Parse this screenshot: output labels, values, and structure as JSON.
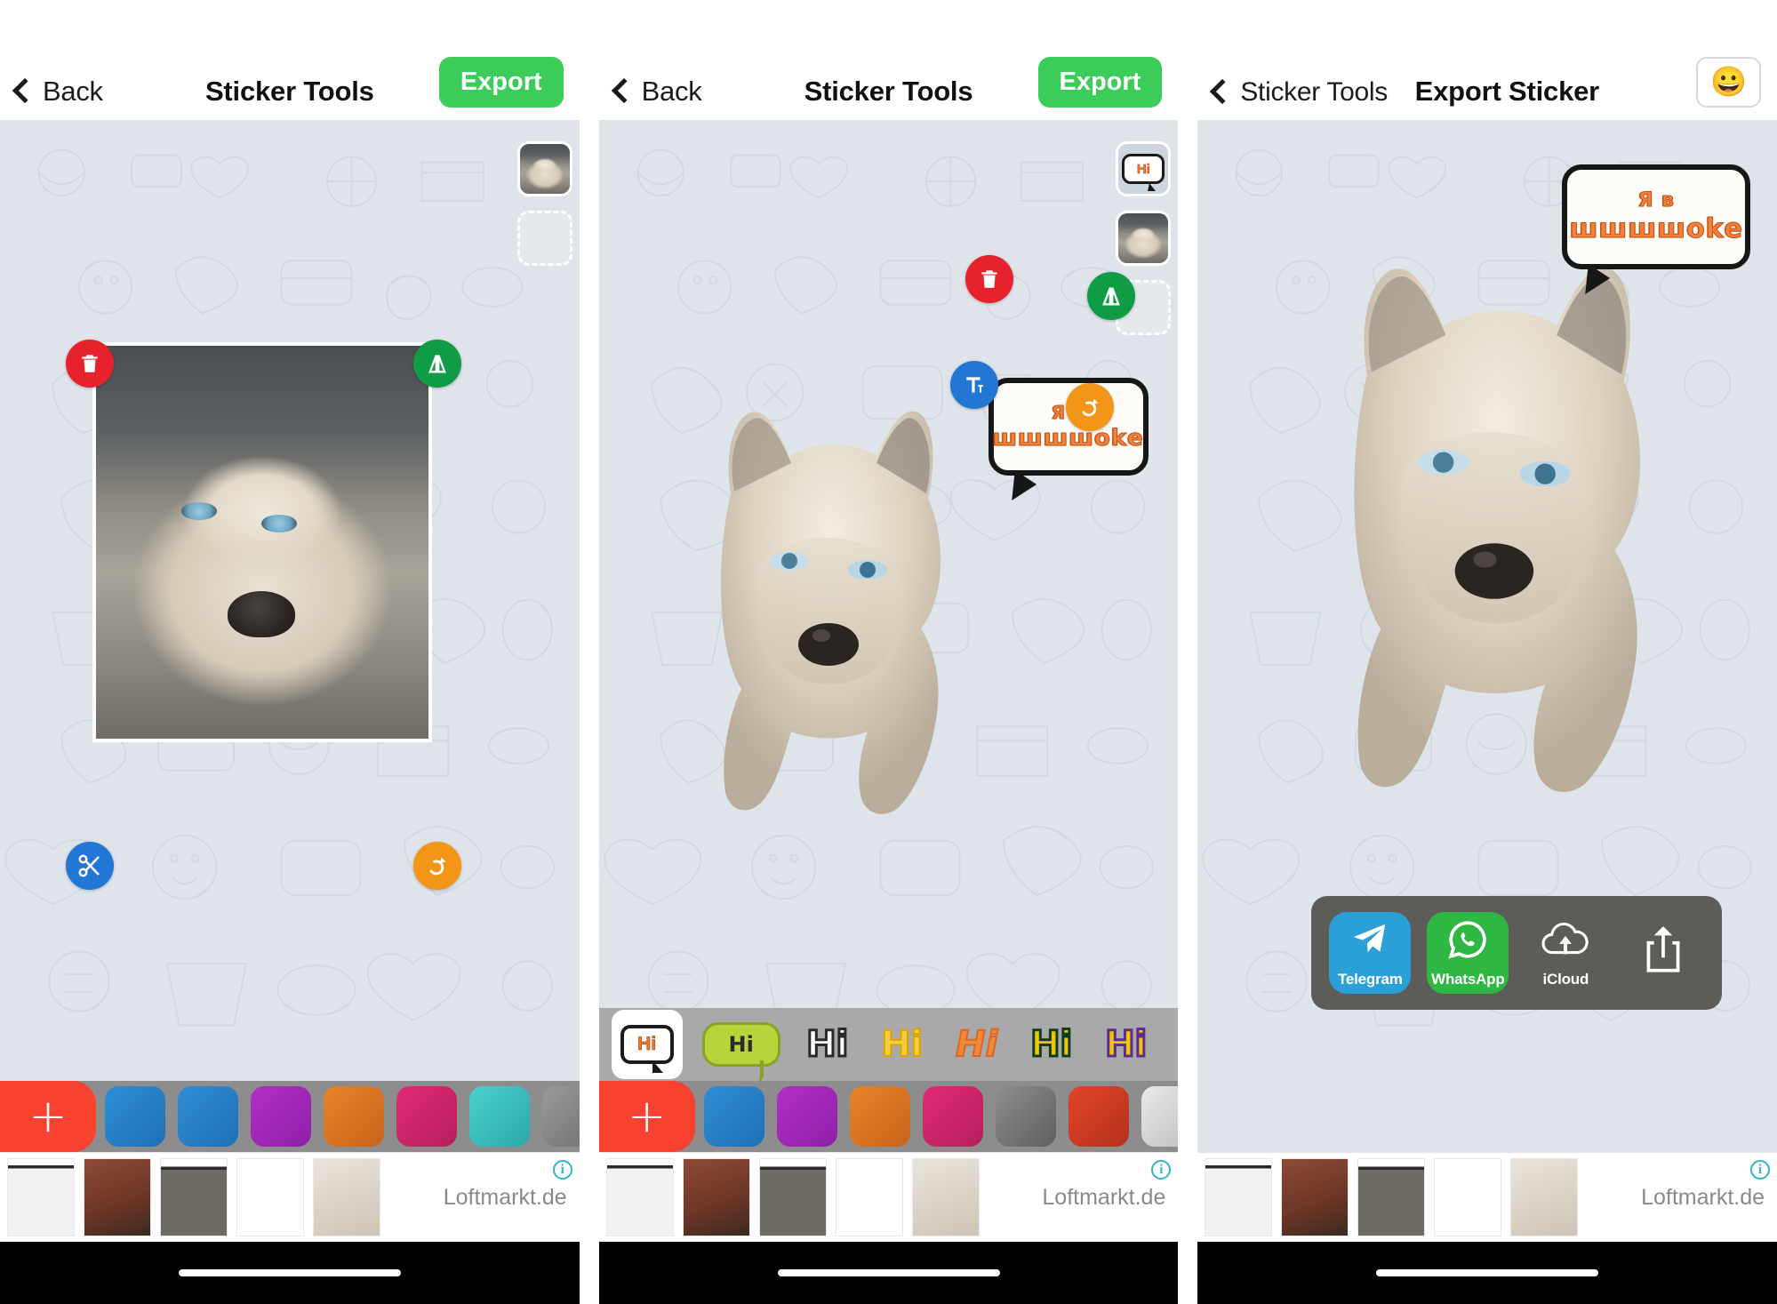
{
  "screens": [
    {
      "id": "panel-1",
      "nav": {
        "back_label": "Back",
        "title": "Sticker Tools",
        "action_label": "Export"
      },
      "tools": [
        {
          "name": "delete",
          "glyph": "trash",
          "color": "#e8222c"
        },
        {
          "name": "flip",
          "glyph": "flip",
          "color": "#0f9c45"
        },
        {
          "name": "crop",
          "glyph": "scissors",
          "color": "#2277d4"
        },
        {
          "name": "rotate",
          "glyph": "rotate",
          "color": "#f39516"
        }
      ],
      "layers": [
        "photo-thumbnail",
        "empty-slot"
      ],
      "bottom_bar": {
        "add_label": "+",
        "stickers": [
          "face-blue-1",
          "face-blue-2",
          "face-magenta",
          "face-orange",
          "face-pink",
          "face-teal",
          "face-gray"
        ]
      },
      "ad": {
        "brand": "Loftmarkt.de",
        "info_glyph": "i"
      }
    },
    {
      "id": "panel-2",
      "nav": {
        "back_label": "Back",
        "title": "Sticker Tools",
        "action_label": "Export"
      },
      "tools": [
        {
          "name": "delete",
          "glyph": "trash",
          "color": "#e8222c"
        },
        {
          "name": "flip",
          "glyph": "flip",
          "color": "#0f9c45"
        },
        {
          "name": "edit-text",
          "glyph": "T",
          "color": "#2277d4"
        },
        {
          "name": "rotate",
          "glyph": "rotate",
          "color": "#f39516"
        }
      ],
      "bubble": {
        "line1": "Я в",
        "line2": "шшшшоkе"
      },
      "layers": [
        "text-bubble-thumbnail",
        "photo-thumbnail",
        "empty-slot"
      ],
      "text_strip": {
        "items": [
          {
            "label": "Hi",
            "style": "bubble",
            "selected": true
          },
          {
            "label": "Hi",
            "style": "green"
          },
          {
            "label": "Hi",
            "style": "white"
          },
          {
            "label": "Hi",
            "style": "yellow"
          },
          {
            "label": "Hi",
            "style": "orange"
          },
          {
            "label": "Hi",
            "style": "gold"
          },
          {
            "label": "Hi",
            "style": "purple"
          }
        ]
      },
      "bottom_bar": {
        "add_label": "+",
        "stickers": [
          "face-blue",
          "face-magenta",
          "face-orange",
          "face-pink",
          "face-gray",
          "face-red",
          "face-white"
        ]
      },
      "ad": {
        "brand": "Loftmarkt.de",
        "info_glyph": "i"
      }
    },
    {
      "id": "panel-3",
      "nav": {
        "back_label": "Sticker Tools",
        "title": "Export Sticker",
        "emoji": "😀"
      },
      "bubble": {
        "line1": "Я в",
        "line2": "шшшшоkе"
      },
      "share": {
        "items": [
          {
            "label": "Telegram",
            "icon": "paper-plane-icon",
            "color": "#2a9fd8"
          },
          {
            "label": "WhatsApp",
            "icon": "whatsapp-icon",
            "color": "#2eb742"
          },
          {
            "label": "iCloud",
            "icon": "icloud-upload-icon",
            "color": "transparent"
          },
          {
            "label": "",
            "icon": "share-export-icon",
            "color": "transparent"
          }
        ]
      },
      "ad": {
        "brand": "Loftmarkt.de",
        "info_glyph": "i"
      }
    }
  ],
  "colors": {
    "export_green": "#3bcc59",
    "canvas_bg": "#dfe4eb",
    "strip_gray": "#8d8d8d",
    "add_red": "#f8412e",
    "share_sheet": "#5e5c59"
  }
}
